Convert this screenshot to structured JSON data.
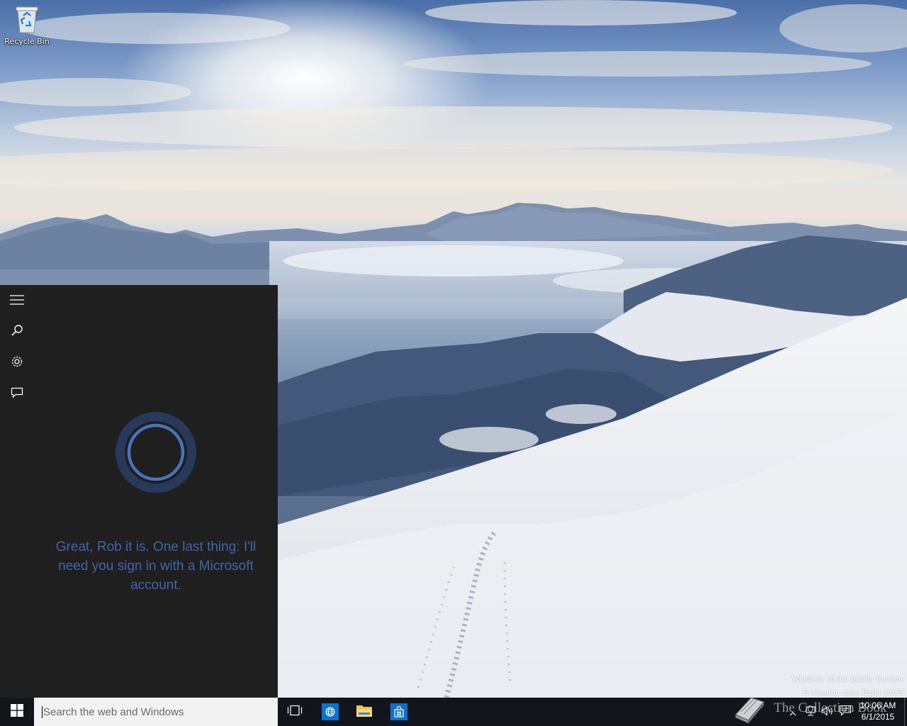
{
  "desktop": {
    "icons": [
      {
        "label": "Recycle Bin",
        "icon": "recycle-bin-icon"
      }
    ],
    "watermark": {
      "line1": "Windows 10 Pro Insider Preview",
      "line2": "Evaluation copy. Build 10135"
    }
  },
  "cortana": {
    "rail": [
      {
        "name": "hamburger-menu",
        "icon": "hamburger-icon"
      },
      {
        "name": "search",
        "icon": "search-icon"
      },
      {
        "name": "settings",
        "icon": "gear-icon"
      },
      {
        "name": "feedback",
        "icon": "feedback-icon"
      }
    ],
    "message": "Great, Rob it is. One last thing: I'll need you sign in with a Microsoft account.",
    "colors": {
      "panel_bg": "#1f1f1f",
      "accent": "#3f66a8"
    }
  },
  "taskbar": {
    "search": {
      "placeholder": "Search the web and Windows",
      "value": ""
    },
    "buttons": [
      {
        "name": "task-view",
        "icon": "task-view-icon"
      },
      {
        "name": "browser",
        "icon": "globe-icon"
      },
      {
        "name": "file-explorer",
        "icon": "folder-icon"
      },
      {
        "name": "store",
        "icon": "store-icon"
      }
    ],
    "tray_icons": [
      "chevron-up-icon",
      "network-icon",
      "volume-icon",
      "action-center-icon"
    ],
    "clock": {
      "time": "10:06 AM",
      "date": "6/1/2015"
    },
    "colors": {
      "bg": "#12161c",
      "search_bg": "#f2f2f2",
      "app_accent": "#0a73d0"
    }
  },
  "overlay": {
    "text": "The Collection Book"
  }
}
